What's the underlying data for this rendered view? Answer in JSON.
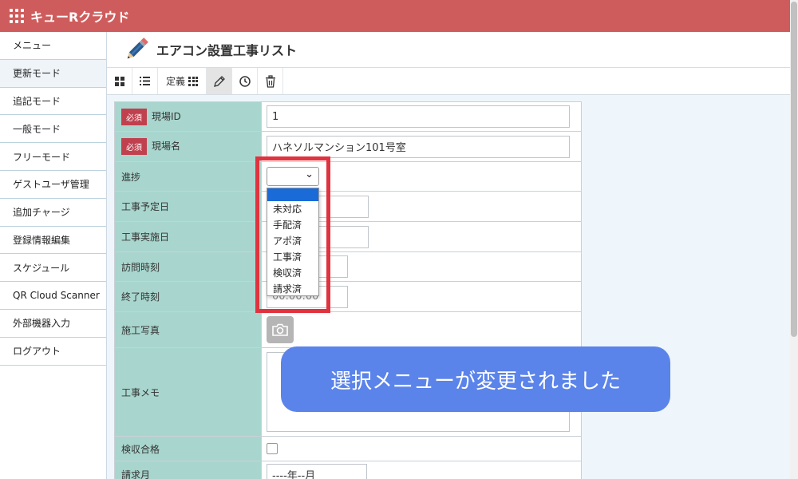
{
  "app": {
    "title": "キューRクラウド"
  },
  "sidebar": {
    "items": [
      {
        "label": "メニュー"
      },
      {
        "label": "更新モード"
      },
      {
        "label": "追記モード"
      },
      {
        "label": "一般モード"
      },
      {
        "label": "フリーモード"
      },
      {
        "label": "ゲストユーザ管理"
      },
      {
        "label": "追加チャージ"
      },
      {
        "label": "登録情報編集"
      },
      {
        "label": "スケジュール"
      },
      {
        "label": "QR Cloud Scanner"
      },
      {
        "label": "外部機器入力"
      },
      {
        "label": "ログアウト"
      }
    ]
  },
  "page": {
    "title": "エアコン設置工事リスト"
  },
  "toolbar": {
    "definition_label": "定義"
  },
  "form": {
    "required_badge": "必須",
    "fields": {
      "site_id": {
        "label": "現場ID",
        "value": "1"
      },
      "site_name": {
        "label": "現場名",
        "value": "ハネソルマンション101号室"
      },
      "progress": {
        "label": "進捗",
        "value": ""
      },
      "scheduled_date": {
        "label": "工事予定日"
      },
      "actual_date": {
        "label": "工事実施日"
      },
      "visit_time": {
        "label": "訪問時刻"
      },
      "end_time": {
        "label": "終了時刻",
        "value": "00:00:00"
      },
      "photos": {
        "label": "施工写真"
      },
      "memo": {
        "label": "工事メモ"
      },
      "inspection": {
        "label": "検収合格"
      },
      "billing_month": {
        "label": "請求月",
        "value": "----年--月"
      }
    }
  },
  "dropdown": {
    "options": [
      "",
      "未対応",
      "手配済",
      "アポ済",
      "工事済",
      "検収済",
      "請求済"
    ]
  },
  "toast": {
    "message": "選択メニューが変更されました"
  },
  "colors": {
    "header": "#cf5c5c",
    "label_bg": "#a8d6ce",
    "required": "#c0404e",
    "toast": "#5b84ea",
    "highlight_frame": "#e0333f"
  }
}
